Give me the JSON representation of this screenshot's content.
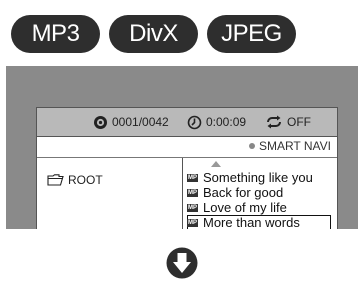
{
  "badges": [
    {
      "label": "MP3"
    },
    {
      "label": "DivX"
    },
    {
      "label": "JPEG"
    }
  ],
  "status": {
    "track": "0001/0042",
    "time": "0:00:09",
    "repeat": "OFF"
  },
  "navi": {
    "label": "SMART NAVI"
  },
  "folder": {
    "label": "ROOT"
  },
  "files": [
    {
      "name": "Something like you",
      "icon": "mp3-file-icon"
    },
    {
      "name": "Back for good",
      "icon": "mp3-file-icon"
    },
    {
      "name": "Love of my life",
      "icon": "mp3-file-icon"
    },
    {
      "name": "More than words",
      "icon": "mp3-file-icon",
      "selected": true
    }
  ],
  "icons": {
    "track": "disc-icon",
    "time": "clock-icon",
    "repeat": "repeat-icon",
    "folder": "folder-icon",
    "scroll_up": "scroll-up-icon",
    "down": "down-arrow-icon"
  },
  "colors": {
    "badge_bg": "#2e2e2e",
    "screen_bg": "#8a8a8a",
    "status_bar_bg": "#b9b9b9"
  }
}
